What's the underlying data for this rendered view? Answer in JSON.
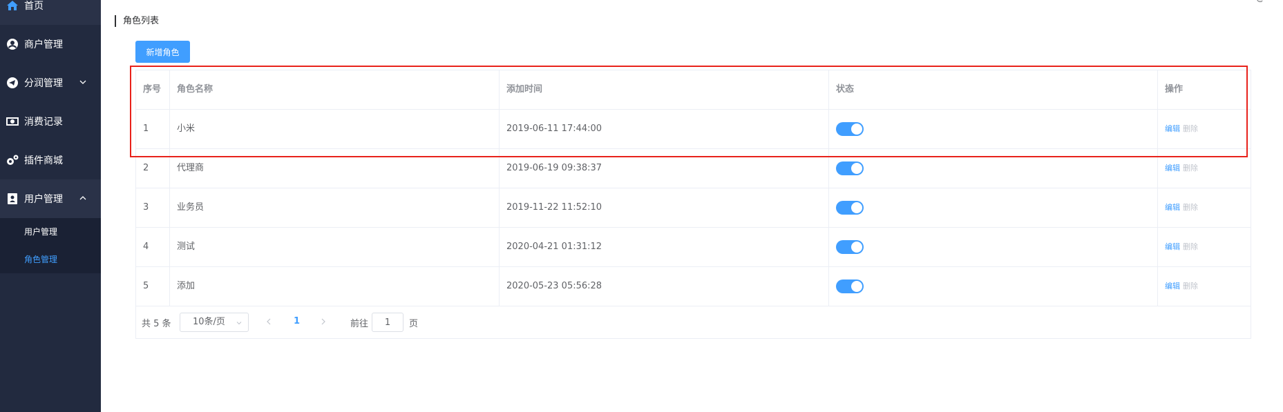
{
  "sidebar": {
    "items": [
      {
        "label": "首页",
        "icon": "home-icon"
      },
      {
        "label": "商户管理",
        "icon": "user-circle-icon"
      },
      {
        "label": "分润管理",
        "icon": "telegram-icon"
      },
      {
        "label": "消费记录",
        "icon": "money-icon"
      },
      {
        "label": "插件商城",
        "icon": "gears-icon"
      },
      {
        "label": "用户管理",
        "icon": "user-card-icon"
      }
    ],
    "submenu": [
      {
        "label": "用户管理",
        "active": false
      },
      {
        "label": "角色管理",
        "active": true
      }
    ]
  },
  "header": {
    "title": "角色列表",
    "corner": "@"
  },
  "toolbar": {
    "add_label": "新增角色"
  },
  "table": {
    "columns": [
      "序号",
      "角色名称",
      "添加时间",
      "状态",
      "操作"
    ],
    "rows": [
      {
        "index": "1",
        "name": "小米",
        "time": "2019-06-11 17:44:00",
        "status": true
      },
      {
        "index": "2",
        "name": "代理商",
        "time": "2019-06-19 09:38:37",
        "status": true
      },
      {
        "index": "3",
        "name": "业务员",
        "time": "2019-11-22 11:52:10",
        "status": true
      },
      {
        "index": "4",
        "name": "测试",
        "time": "2020-04-21 01:31:12",
        "status": true
      },
      {
        "index": "5",
        "name": "添加",
        "time": "2020-05-23 05:56:28",
        "status": true
      }
    ],
    "actions": {
      "edit": "编辑",
      "delete": "删除"
    }
  },
  "pagination": {
    "total": "共 5 条",
    "page_size": "10条/页",
    "current_page": "1",
    "goto_label": "前往",
    "goto_value": "1",
    "page_label": "页"
  },
  "colors": {
    "accent": "#409eff",
    "sidebar": "#222a3f",
    "highlight": "#e8211a"
  }
}
